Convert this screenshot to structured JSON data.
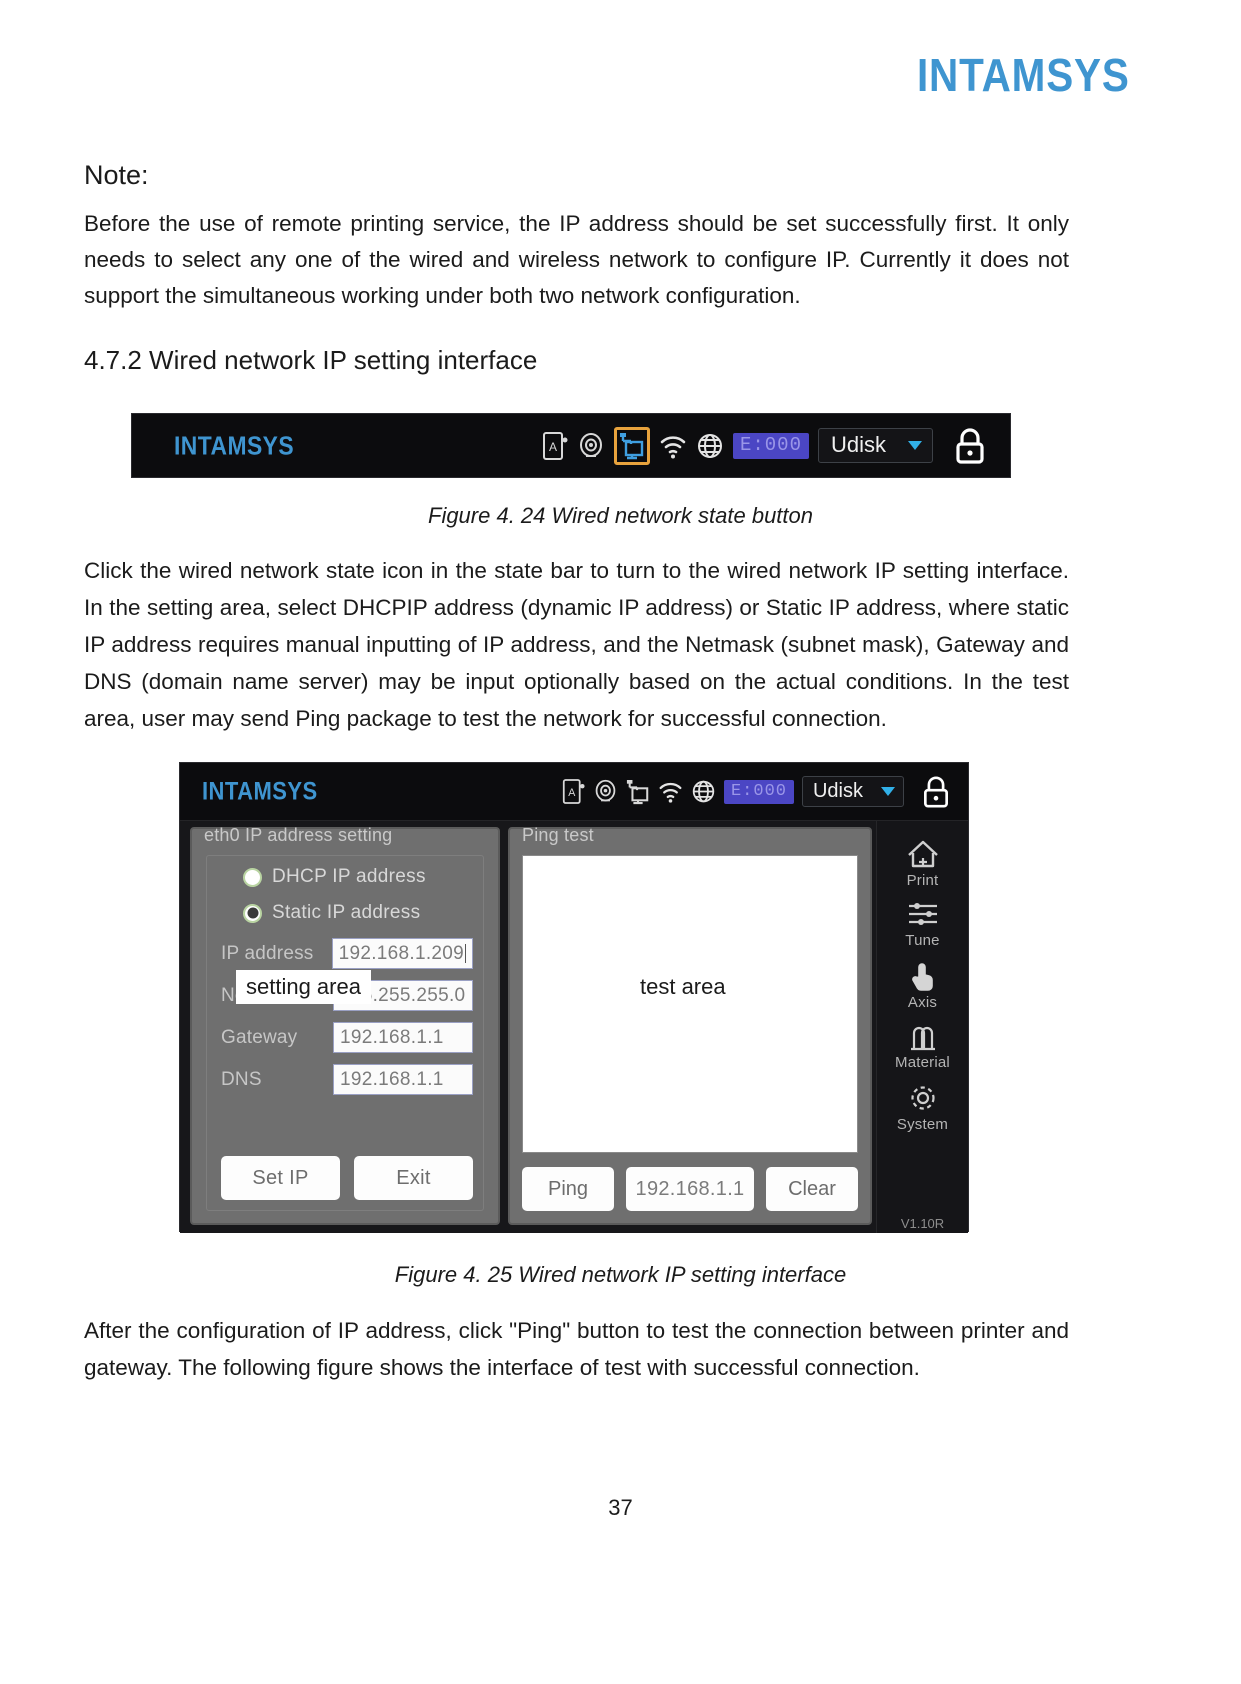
{
  "document": {
    "brand": "INTAMSYS",
    "note_title": "Note:",
    "note_body": "Before the use of remote printing service, the IP address should be set successfully first. It only needs to select any one of the wired and wireless network to configure IP. Currently it does not support the simultaneous working under both two network configuration.",
    "section_heading": "4.7.2 Wired network IP setting interface",
    "figure_24_caption": "Figure 4. 24 Wired network state button",
    "body_paragraph_1": "Click the wired network state icon in the state bar to turn to the wired network IP setting interface. In the setting area, select DHCPIP address (dynamic IP address) or Static IP address, where static IP address requires manual inputting of IP address, and the Netmask (subnet mask), Gateway and DNS (domain name server) may be input optionally based on the actual conditions. In the test area, user may send Ping package to test the network for successful connection.",
    "figure_25_caption": "Figure 4. 25 Wired network IP setting interface",
    "body_paragraph_2": "After the configuration of IP address, click \"Ping\" button to test the connection between printer and gateway. The following figure shows the interface of test with successful connection.",
    "page_number": "37"
  },
  "statusbar": {
    "logo": "INTAMSYS",
    "icons": [
      {
        "name": "nozzle-lock-icon",
        "label": "A"
      },
      {
        "name": "bed-leveling-icon",
        "label": ""
      },
      {
        "name": "wired-network-icon",
        "label": "",
        "highlighted": true
      },
      {
        "name": "wifi-icon",
        "label": ""
      },
      {
        "name": "globe-network-icon",
        "label": ""
      }
    ],
    "error_code": "E:000",
    "storage_label": "Udisk",
    "dropdown_caret": "caret-down-icon",
    "lock_icon": "lock-icon",
    "highlight_color": "#e8a33d",
    "accent_color": "#3f95d0",
    "error_chip_bg": "#4b46c4"
  },
  "device_ui": {
    "settings": {
      "panel_title": "eth0 IP address setting",
      "radio_options": [
        {
          "label": "DHCP IP address",
          "selected": false
        },
        {
          "label": "Static IP address",
          "selected": true
        }
      ],
      "fields": [
        {
          "label": "IP address",
          "value": "192.168.1.209",
          "focused": true
        },
        {
          "label": "Netmask",
          "value": "255.255.255.0",
          "focused": false
        },
        {
          "label": "Gateway",
          "value": "192.168.1.1",
          "focused": false
        },
        {
          "label": "DNS",
          "value": "192.168.1.1",
          "focused": false
        }
      ],
      "buttons": [
        {
          "label": "Set IP"
        },
        {
          "label": "Exit"
        }
      ]
    },
    "test": {
      "panel_title": "Ping test",
      "log_text": "",
      "ping_button": "Ping",
      "ping_target": "192.168.1.1",
      "clear_button": "Clear"
    },
    "rail": [
      {
        "name": "print",
        "label": "Print",
        "icon": "home-icon"
      },
      {
        "name": "tune",
        "label": "Tune",
        "icon": "sliders-icon"
      },
      {
        "name": "axis",
        "label": "Axis",
        "icon": "hand-touch-icon"
      },
      {
        "name": "material",
        "label": "Material",
        "icon": "filament-spools-icon"
      },
      {
        "name": "system",
        "label": "System",
        "icon": "gear-icon"
      }
    ],
    "version": "V1.10R"
  },
  "annotations": {
    "setting_area": "setting area",
    "test_area": "test area"
  }
}
